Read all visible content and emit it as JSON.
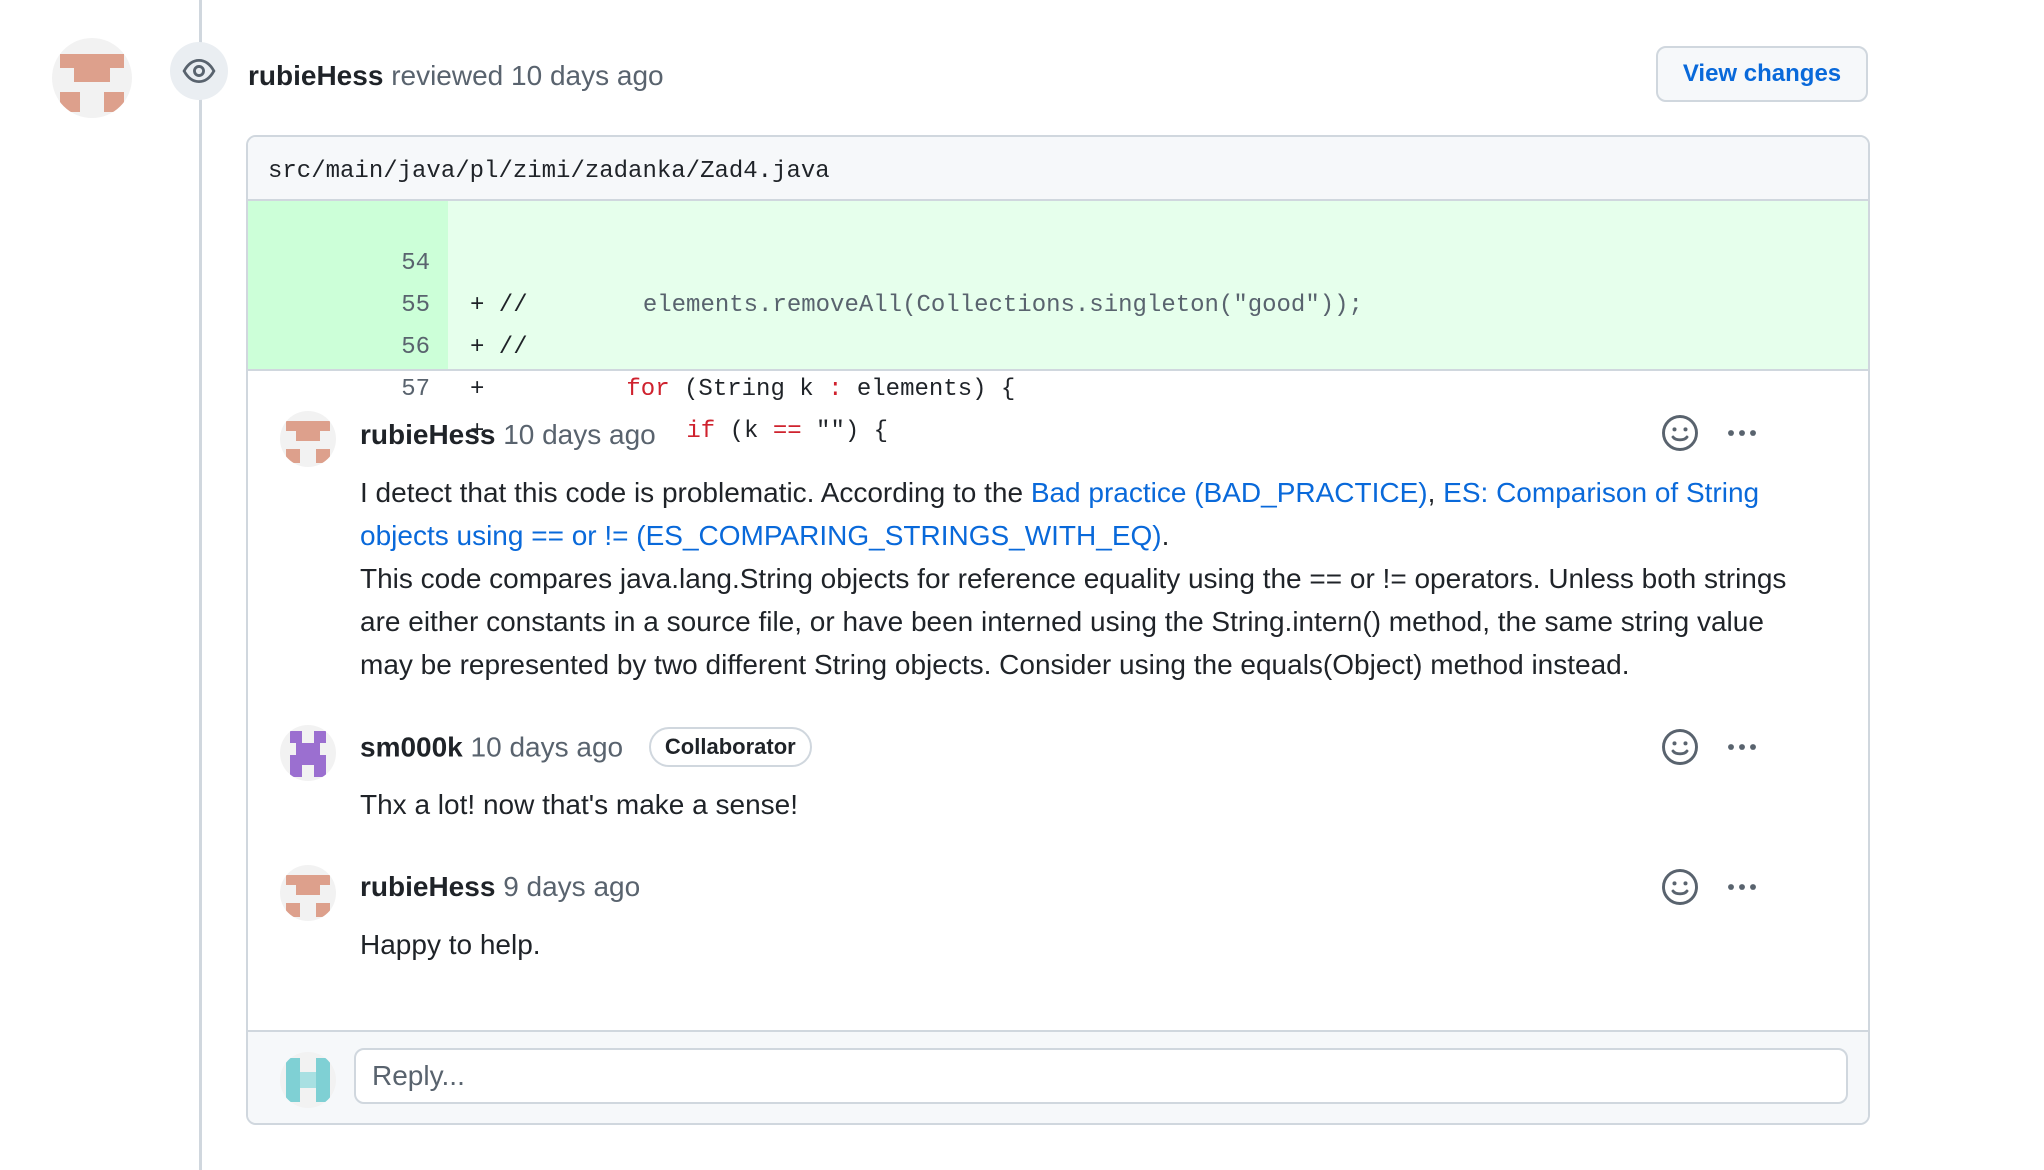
{
  "review": {
    "author": "rubieHess",
    "verb": "reviewed",
    "time": "10 days ago",
    "view_changes_label": "View changes"
  },
  "file": {
    "path": "src/main/java/pl/zimi/zadanka/Zad4.java"
  },
  "diff": {
    "lines": [
      {
        "num": "54",
        "prefix": "+ //",
        "text": "        elements.removeAll(Collections.singleton(\"good\"));"
      },
      {
        "num": "55",
        "prefix": "+ //",
        "text": ""
      },
      {
        "num": "56",
        "prefix": "+",
        "text": "for (String k : elements) {"
      },
      {
        "num": "57",
        "prefix": "+",
        "text": "if (k == \"\") {"
      }
    ]
  },
  "comments": [
    {
      "author": "rubieHess",
      "time": "10 days ago",
      "body_prefix": "I detect that this code is problematic. According to the ",
      "link1": "Bad practice (BAD_PRACTICE)",
      "sep": ", ",
      "link2": "ES: Comparison of String objects using == or != (ES_COMPARING_STRINGS_WITH_EQ)",
      "body_suffix": ".",
      "body_detail": "This code compares java.lang.String objects for reference equality using the == or != operators. Unless both strings are either constants in a source file, or have been interned using the String.intern() method, the same string value may be represented by two different String objects. Consider using the equals(Object) method instead."
    },
    {
      "author": "sm000k",
      "time": "10 days ago",
      "badge": "Collaborator",
      "body": "Thx a lot! now that's make a sense!"
    },
    {
      "author": "rubieHess",
      "time": "9 days ago",
      "body": "Happy to help."
    }
  ],
  "reply": {
    "placeholder": "Reply..."
  },
  "icons": {
    "review": "eye-icon",
    "reaction": "smiley-icon",
    "more": "kebab-horizontal-icon"
  },
  "colors": {
    "link": "#0969da",
    "added_bg": "#e6ffec",
    "added_gutter": "#ccffd8",
    "keyword": "#cf222e"
  }
}
